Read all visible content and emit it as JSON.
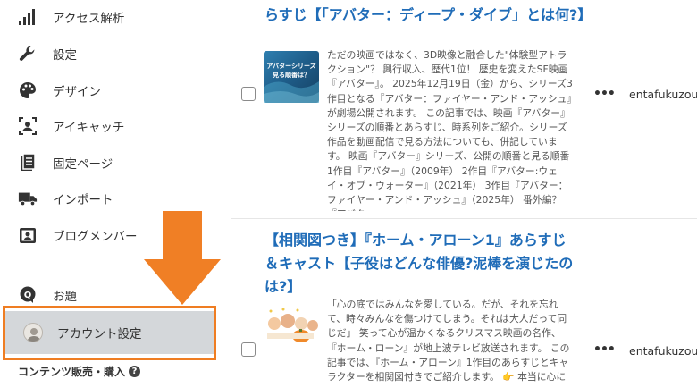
{
  "sidebar": {
    "items": [
      {
        "label": "アクセス解析",
        "icon": "bar-chart-icon"
      },
      {
        "label": "設定",
        "icon": "wrench-icon"
      },
      {
        "label": "デザイン",
        "icon": "palette-icon"
      },
      {
        "label": "アイキャッチ",
        "icon": "eyecatch-image-icon"
      },
      {
        "label": "固定ページ",
        "icon": "page-icon"
      },
      {
        "label": "インポート",
        "icon": "truck-icon"
      },
      {
        "label": "ブログメンバー",
        "icon": "members-icon"
      },
      {
        "label": "お題",
        "icon": "topic-icon"
      },
      {
        "label": "アカウント設定",
        "icon": "avatar"
      }
    ],
    "content_sales": "コンテンツ販売・購入",
    "help_glyph": "?"
  },
  "articles": [
    {
      "title": "らすじ【「アバター：ディープ・ダイブ」とは何?】",
      "thumbnail_text": "アバターシリーズ見る順番は？",
      "excerpt": "ただの映画ではなく、3D映像と融合した\"体験型アトラクション\"？ 興行収入、歴代1位！ 歴史を変えたSF映画『アバター』。 2025年12月19日（金）から、シリーズ3作目となる『アバター：ファイヤー・アンド・アッシュ』が劇場公開されます。 この記事では、映画『アバター』シリーズの順番とあらすじ、時系列をご紹介。シリーズ作品を動画配信で見る方法についても、併記しています。 映画『アバター』シリーズ、公開の順番と見る順番 1作目『アバター』（2009年） 2作目『アバター:ウェイ・オブ・ウォーター』（2021年） 3作目『アバター：ファイヤー・アンド・アッシュ』（2025年） 番外編？『アバター…",
      "author": "entafukuzou"
    },
    {
      "title": "【相関図つき】『ホーム・アローン1』あらすじ＆キャスト【子役はどんな俳優?泥棒を演じたのは?】",
      "excerpt": "「心の底ではみんなを愛している。だが、それを忘れて、時々みんなを傷つけてしまう。それは大人だって同じだ」 笑って心が温かくなるクリスマス映画の名作、『ホーム・ローン』が地上波テレビ放送されます。 この記事では、『ホーム・アローン』1作目のあらすじとキャラクターを相関図付きでご紹介します。 👉 本当に心に",
      "author": "entafukuzou"
    }
  ],
  "more_glyph": "•••",
  "colors": {
    "accent_orange": "#ef7d22",
    "link_blue": "#1f6cb8",
    "selected_bg": "#d4d7da"
  }
}
